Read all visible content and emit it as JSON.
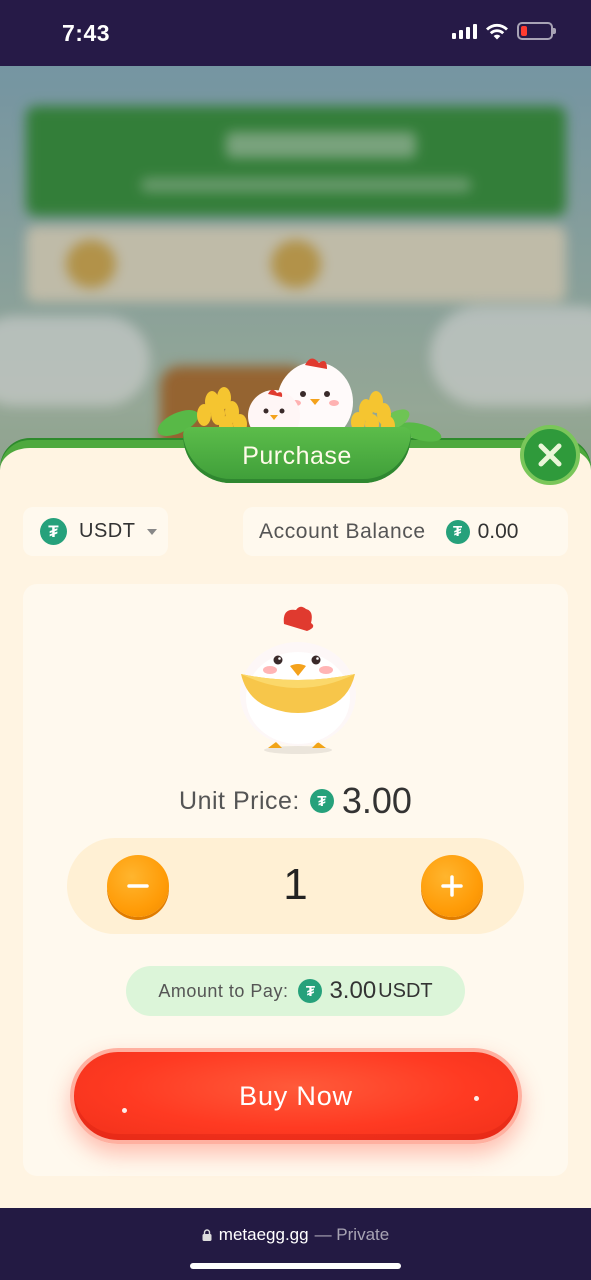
{
  "status_bar": {
    "time": "7:43",
    "icons": [
      "cellular-signal-icon",
      "wifi-icon",
      "battery-low-icon"
    ],
    "battery_color": "#ff3b30"
  },
  "modal": {
    "title": "Purchase",
    "close_icon": "close-x-icon",
    "currency": {
      "label": "USDT",
      "icon": "tether-icon",
      "dropdown_icon": "caret-down-icon"
    },
    "balance": {
      "label": "Account Balance",
      "value": "0.00",
      "icon": "tether-icon"
    },
    "product": {
      "image": "chick-image",
      "unit_price_label": "Unit Price:",
      "unit_price_value": "3.00"
    },
    "quantity": {
      "value": "1",
      "decrease_icon": "minus-icon",
      "increase_icon": "plus-icon"
    },
    "amount": {
      "label": "Amount to Pay:",
      "value": "3.00",
      "unit": "USDT"
    },
    "buy_button_label": "Buy Now"
  },
  "browser": {
    "domain": "metaegg.gg",
    "separator_private": "— Private",
    "lock_icon": "lock-icon"
  },
  "colors": {
    "accent_green": "#4fa93e",
    "tether_green": "#26a17b",
    "button_orange": "#ff9c08",
    "buy_red": "#ff3a22",
    "panel_bg": "#fff4e2"
  }
}
